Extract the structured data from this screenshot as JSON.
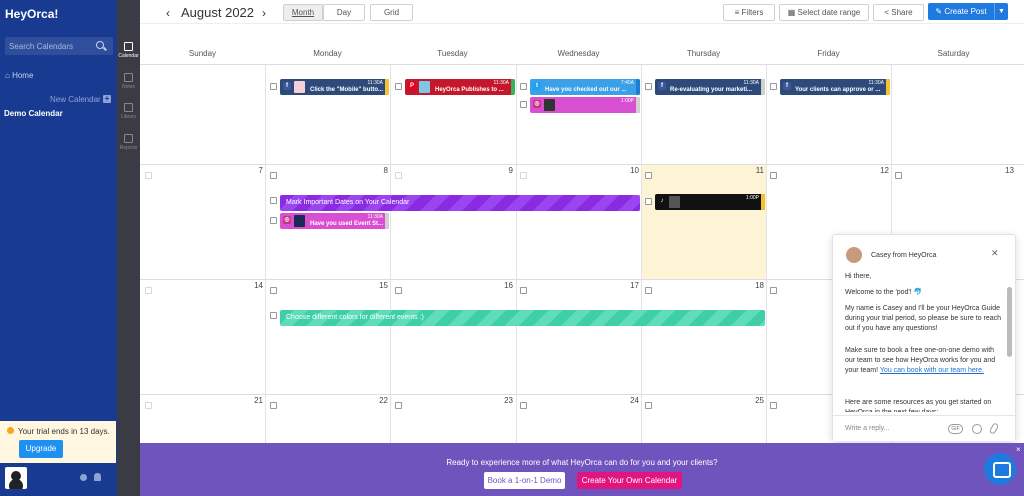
{
  "sidebar": {
    "logo": "HeyOrca!",
    "search_placeholder": "Search Calendars",
    "home": "Home",
    "new_calendar": "New Calendar",
    "calendar_name": "Demo Calendar",
    "trial_text": "Your trial ends in 13 days.",
    "upgrade": "Upgrade"
  },
  "rail": [
    "Calendar",
    "Notes",
    "Library",
    "Reports"
  ],
  "toolbar": {
    "month": "August 2022",
    "views": [
      "Month",
      "Day",
      "Grid"
    ],
    "filters": "Filters",
    "date_range": "Select date range",
    "share": "Share",
    "create_post": "Create Post"
  },
  "days": [
    "Sunday",
    "Monday",
    "Tuesday",
    "Wednesday",
    "Thursday",
    "Friday",
    "Saturday"
  ],
  "week2": [
    "7",
    "8",
    "9",
    "10",
    "11",
    "12",
    "13"
  ],
  "week3": [
    "14",
    "15",
    "16",
    "17",
    "18"
  ],
  "week4": [
    "21",
    "22",
    "23",
    "24",
    "25"
  ],
  "posts": [
    {
      "name": "Click the \"Mobile\" butto...",
      "time": "11:30A",
      "color": "#2d4a7a",
      "bar": "#f2c230"
    },
    {
      "name": "HeyOrca Publishes to ...",
      "time": "11:30A",
      "color": "#c4172b",
      "bar": "#34b55a"
    },
    {
      "name": "Have you checked out our ...",
      "time": "7:40A",
      "color": "#3aa0e8",
      "bar": "#3aa0e8"
    },
    {
      "name": "",
      "time": "1:00P",
      "color": "#d94fd2",
      "bar": "#d0d0d0"
    },
    {
      "name": "Re-evaluating your marketi...",
      "time": "11:30A",
      "color": "#2d4a7a",
      "bar": "#d0d0d0"
    },
    {
      "name": "Your clients can approve or ...",
      "time": "11:30A",
      "color": "#2d4a7a",
      "bar": "#f2c230"
    },
    {
      "name": "Have you used Event St...",
      "time": "11:30A",
      "color": "#d94fd2",
      "bar": "#d0d0d0"
    },
    {
      "name": "",
      "time": "1:00P",
      "color": "#111111",
      "bar": "#f2c230"
    }
  ],
  "events": {
    "mark_dates": "Mark Important Dates on Your Calendar",
    "colors": "Choose different colors for different events :)"
  },
  "chat": {
    "from": "Casey from HeyOrca",
    "hi": "Hi there,",
    "welcome": "Welcome to the 'pod'! 🐬",
    "intro": "My name is Casey and I'll be your HeyOrca Guide during your trial period, so please be sure to reach out if you have any questions!",
    "demo": "Make sure to book a free one-on-one demo with our team to see how HeyOrca works for you and your team!",
    "link": "You can book with our team here.",
    "resources": "Here are some resources as you get started on HeyOrca in the next few days:",
    "input_placeholder": "Write a reply...",
    "gif": "GIF"
  },
  "banner": {
    "text": "Ready to experience more of what HeyOrca can do for you and your clients?",
    "demo": "Book a 1-on-1 Demo",
    "create": "Create Your Own Calendar"
  }
}
